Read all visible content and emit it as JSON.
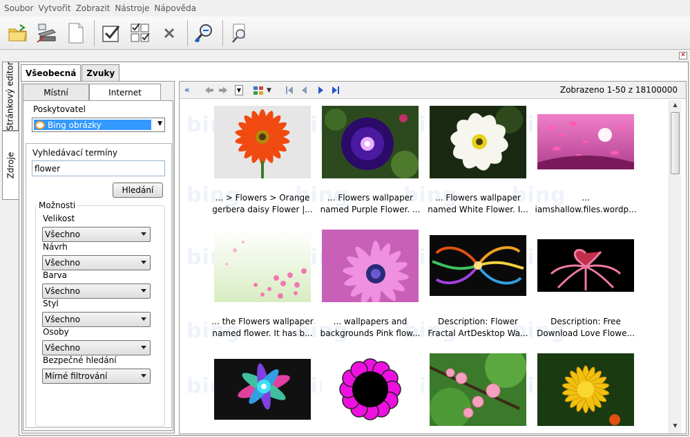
{
  "menu": [
    "Soubor",
    "Vytvořit",
    "Zobrazit",
    "Nástroje",
    "Nápověda"
  ],
  "sidetabs": {
    "editor": "Stránkový editor",
    "sources": "Zdroje"
  },
  "tabs": {
    "general": "Všeobecná",
    "sounds": "Zvuky"
  },
  "subtabs": {
    "local": "Místní",
    "internet": "Internet"
  },
  "provider": {
    "label": "Poskytovatel",
    "value": "Bing obrázky"
  },
  "search": {
    "label": "Vyhledávací termíny",
    "value": "flower",
    "button": "Hledání"
  },
  "options": {
    "title": "Možnosti",
    "fields": [
      {
        "label": "Velikost",
        "value": "Všechno"
      },
      {
        "label": "Návrh",
        "value": "Všechno"
      },
      {
        "label": "Barva",
        "value": "Všechno"
      },
      {
        "label": "Styl",
        "value": "Všechno"
      },
      {
        "label": "Osoby",
        "value": "Všechno"
      },
      {
        "label": "Bezpečné hledání",
        "value": "Mírné filtrování"
      }
    ]
  },
  "results": {
    "count_label": "Zobrazeno 1-50 z 18100000",
    "watermark": "bing",
    "items": [
      {
        "caption1": "... > Flowers > Orange",
        "caption2": "gerbera daisy Flower |...",
        "icon": "orange-gerbera-image"
      },
      {
        "caption1": "... Flowers wallpaper",
        "caption2": "named Purple Flower. ...",
        "icon": "purple-flower-image"
      },
      {
        "caption1": "... Flowers wallpaper",
        "caption2": "named White Flower. I...",
        "icon": "white-flower-image"
      },
      {
        "caption1": "...",
        "caption2": "iamshallow.files.wordp...",
        "icon": "pink-petals-image"
      },
      {
        "caption1": "... the Flowers wallpaper",
        "caption2": "named flower. It has b...",
        "icon": "pink-blossoms-image"
      },
      {
        "caption1": "... wallpapers and",
        "caption2": "backgrounds Pink flow...",
        "icon": "pink-daisy-image"
      },
      {
        "caption1": "Description: Flower",
        "caption2": "Fractal ArtDesktop Wa...",
        "icon": "fractal-flower-image"
      },
      {
        "caption1": "Description: Free",
        "caption2": "Download Love Flowe...",
        "icon": "love-flower-image"
      },
      {
        "caption1": "",
        "caption2": "",
        "icon": "colorful-fractal-image"
      },
      {
        "caption1": "",
        "caption2": "",
        "icon": "magenta-cartoon-flower-image"
      },
      {
        "caption1": "",
        "caption2": "",
        "icon": "pink-blossom-branch-image"
      },
      {
        "caption1": "",
        "caption2": "",
        "icon": "yellow-dahlia-image"
      }
    ]
  }
}
